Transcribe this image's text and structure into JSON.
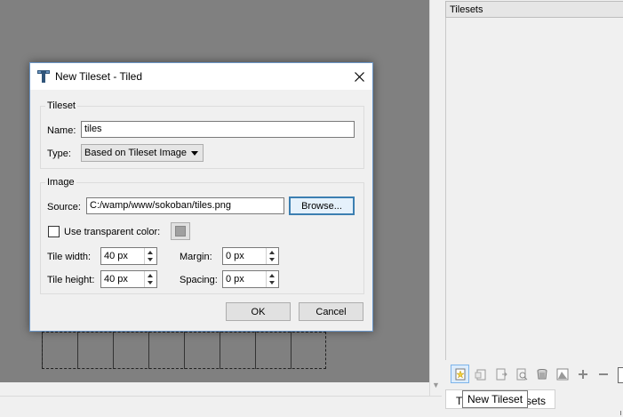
{
  "dialog": {
    "title": "New Tileset - Tiled",
    "tileset_group": {
      "label": "Tileset",
      "name_label": "Name:",
      "name_value": "tiles",
      "type_label": "Type:",
      "type_value": "Based on Tileset Image"
    },
    "image_group": {
      "label": "Image",
      "source_label": "Source:",
      "source_value": "C:/wamp/www/sokoban/tiles.png",
      "browse_label": "Browse...",
      "transparent_label": "Use transparent color:",
      "transparent_checked": false,
      "tile_width_label": "Tile width:",
      "tile_width_value": "40 px",
      "tile_height_label": "Tile height:",
      "tile_height_value": "40 px",
      "margin_label": "Margin:",
      "margin_value": "0 px",
      "spacing_label": "Spacing:",
      "spacing_value": "0 px"
    },
    "ok_label": "OK",
    "cancel_label": "Cancel"
  },
  "panel": {
    "header": "Tilesets",
    "tab_left_fragment": "T",
    "tab_right_fragment": "sets",
    "toolbar_icons": [
      "new-tileset-icon",
      "import-tileset-icon",
      "export-tileset-icon",
      "tileset-properties-icon",
      "delete-tileset-icon",
      "edit-terrain-icon",
      "add-icon",
      "remove-icon"
    ]
  },
  "tooltip": "New Tileset",
  "colors": {
    "canvas_bg": "#808080",
    "dialog_border": "#6a96c8",
    "default_button_border": "#3c7fb1",
    "tooltip_bg": "#ffffff"
  }
}
